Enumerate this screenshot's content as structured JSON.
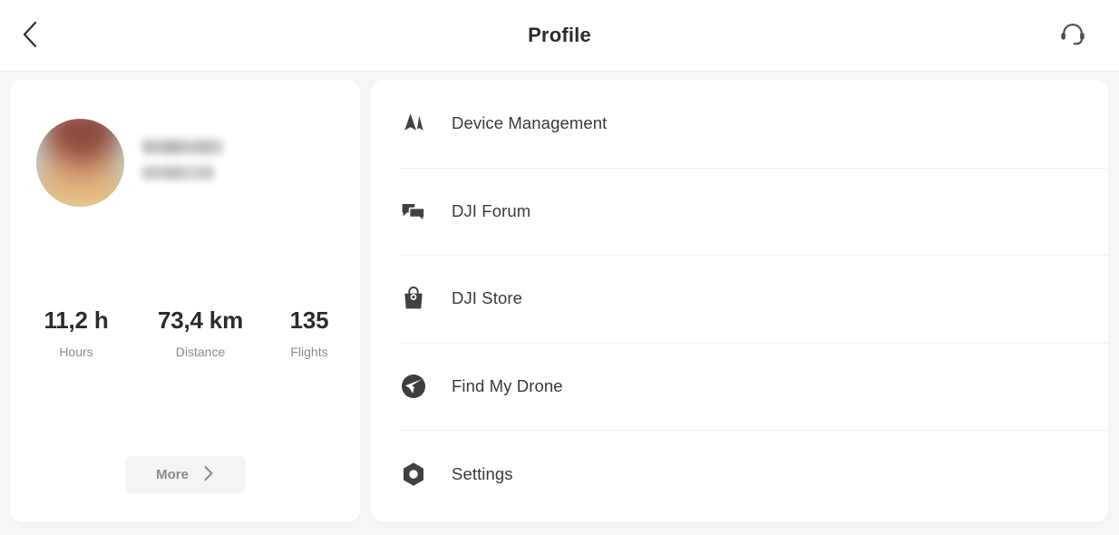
{
  "header": {
    "title": "Profile",
    "back_icon": "chevron-left-icon",
    "support_icon": "headset-support-icon"
  },
  "profile": {
    "avatar_icon": "user-avatar-photo",
    "name_redacted": "",
    "subtitle_redacted": "",
    "stats": [
      {
        "value": "11,2 h",
        "label": "Hours"
      },
      {
        "value": "73,4 km",
        "label": "Distance"
      },
      {
        "value": "135",
        "label": "Flights"
      }
    ],
    "more_label": "More",
    "more_icon": "chevron-right-icon"
  },
  "menu": {
    "items": [
      {
        "label": "Device Management",
        "icon": "drone-aircraft-icon"
      },
      {
        "label": "DJI Forum",
        "icon": "speech-bubbles-icon"
      },
      {
        "label": "DJI Store",
        "icon": "shopping-bag-icon"
      },
      {
        "label": "Find My Drone",
        "icon": "find-drone-compass-icon"
      },
      {
        "label": "Settings",
        "icon": "hex-nut-gear-icon"
      }
    ]
  },
  "colors": {
    "page_background": "#f6f6f6",
    "card_background": "#ffffff",
    "title_text": "#2b2b2b",
    "menu_text": "#3a3a3a",
    "muted_text": "#8c8c8c",
    "divider": "#f2f2f2",
    "icon_dark": "#3f4244",
    "more_button_background": "#f4f4f4"
  }
}
